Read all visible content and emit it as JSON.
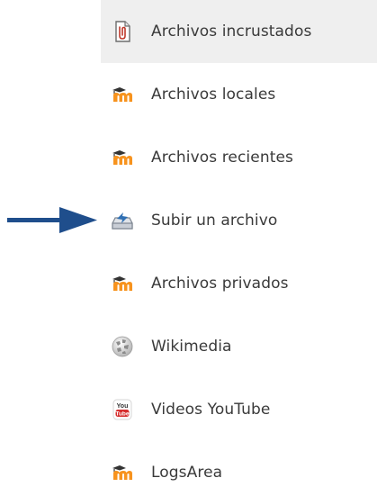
{
  "repository_menu": {
    "items": [
      {
        "label": "Archivos incrustados",
        "icon": "embedded-files-icon",
        "active": true
      },
      {
        "label": "Archivos locales",
        "icon": "moodle-icon",
        "active": false
      },
      {
        "label": "Archivos recientes",
        "icon": "moodle-icon",
        "active": false
      },
      {
        "label": "Subir un archivo",
        "icon": "upload-icon",
        "active": false
      },
      {
        "label": "Archivos privados",
        "icon": "moodle-icon",
        "active": false
      },
      {
        "label": "Wikimedia",
        "icon": "wikimedia-icon",
        "active": false
      },
      {
        "label": "Videos YouTube",
        "icon": "youtube-icon",
        "active": false
      },
      {
        "label": "LogsArea",
        "icon": "moodle-icon",
        "active": false
      }
    ]
  },
  "annotation": {
    "arrow_icon": "arrow-right-icon",
    "arrow_color": "#1f4e8c"
  },
  "colors": {
    "active_background": "#efefef",
    "label_text": "#3a3a3a",
    "moodle_orange": "#f7931e",
    "moodle_dark": "#333333"
  }
}
